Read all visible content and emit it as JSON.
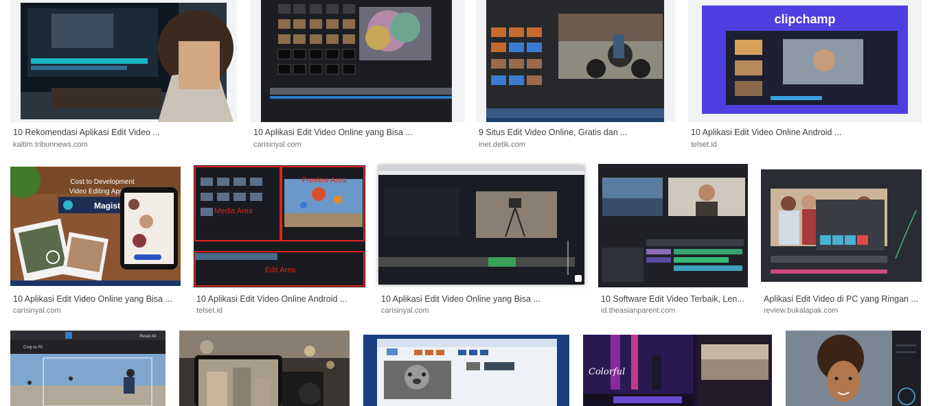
{
  "results": [
    {
      "title": "10 Rekomendasi Aplikasi Edit Video ...",
      "source": "kaltim.tribunnews.com",
      "image": "person-at-monitor-editing-video"
    },
    {
      "title": "10 Aplikasi Edit Video Online yang Bisa ...",
      "source": "carisinyal.com",
      "image": "effects-grid-editor"
    },
    {
      "title": "9 Situs Edit Video Online, Gratis dan ...",
      "source": "inet.detik.com",
      "image": "motorcycle-editor"
    },
    {
      "title": "10 Aplikasi Edit Video Online Android ...",
      "source": "telset.id",
      "image": "clipchamp-editor",
      "overlay_text": "clipchamp"
    },
    {
      "title": "10 Aplikasi Edit Video Online yang Bisa ...",
      "source": "carisinyal.com",
      "image": "magisto-promo",
      "overlay_text": [
        "Cost to Development",
        "Video Editing App like",
        "Magisto"
      ]
    },
    {
      "title": "10 Aplikasi Edit Video Online Android ...",
      "source": "telset.id",
      "image": "annotated-editor",
      "overlay_text": [
        "Preview Area",
        "Media Area",
        "Edit Area"
      ]
    },
    {
      "title": "10 Aplikasi Edit Video Online yang Bisa ...",
      "source": "carisinyal.com",
      "image": "camera-tripod-editor"
    },
    {
      "title": "10 Software Edit Video Terbaik, Len...",
      "source": "id.theasianparent.com",
      "image": "premiere-style-editor"
    },
    {
      "title": "Aplikasi Edit Video di PC yang Ringan ...",
      "source": "review.bukalapak.com",
      "image": "group-photo-editor"
    },
    {
      "title": "",
      "source": "",
      "image": "skateboard-crop-editor",
      "overlay_text": [
        "Crop to Fit",
        "Reset All"
      ]
    },
    {
      "title": "",
      "source": "",
      "image": "phone-gimbal-photo"
    },
    {
      "title": "",
      "source": "",
      "image": "koala-movie-maker"
    },
    {
      "title": "",
      "source": "",
      "image": "colorful-mobile-editor",
      "overlay_text": [
        "Colorful"
      ]
    },
    {
      "title": "",
      "source": "",
      "image": "portrait-color-grading"
    }
  ],
  "colors": {
    "caption": "#3c4043",
    "source": "#70757a",
    "clipchamp": "#4f3ee0",
    "annotation_red": "#e0241b"
  }
}
